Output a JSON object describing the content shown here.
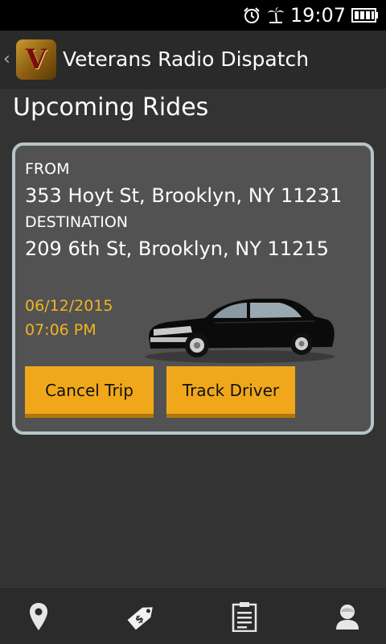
{
  "status_bar": {
    "time": "19:07",
    "icons": [
      "alarm-icon",
      "palm-tree-icon",
      "battery-icon"
    ]
  },
  "action_bar": {
    "back_glyph": "‹",
    "logo_letter": "V",
    "title": "Veterans Radio Dispatch"
  },
  "page": {
    "title": "Upcoming Rides"
  },
  "ride": {
    "from_label": "FROM",
    "from_address": "353 Hoyt St, Brooklyn, NY 11231",
    "destination_label": "DESTINATION",
    "destination_address": "209 6th St, Brooklyn, NY 11215",
    "date": "06/12/2015",
    "time": "07:06 PM",
    "cancel_label": "Cancel Trip",
    "track_label": "Track Driver"
  },
  "bottom_nav": {
    "items": [
      {
        "icon": "location-pin-icon"
      },
      {
        "icon": "price-tag-icon"
      },
      {
        "icon": "clipboard-icon"
      },
      {
        "icon": "profile-icon"
      }
    ]
  },
  "colors": {
    "accent": "#f0a81a",
    "date_text": "#f2b41e",
    "card_background": "#525252",
    "card_border": "#b7c4c8",
    "page_background": "#333333"
  }
}
